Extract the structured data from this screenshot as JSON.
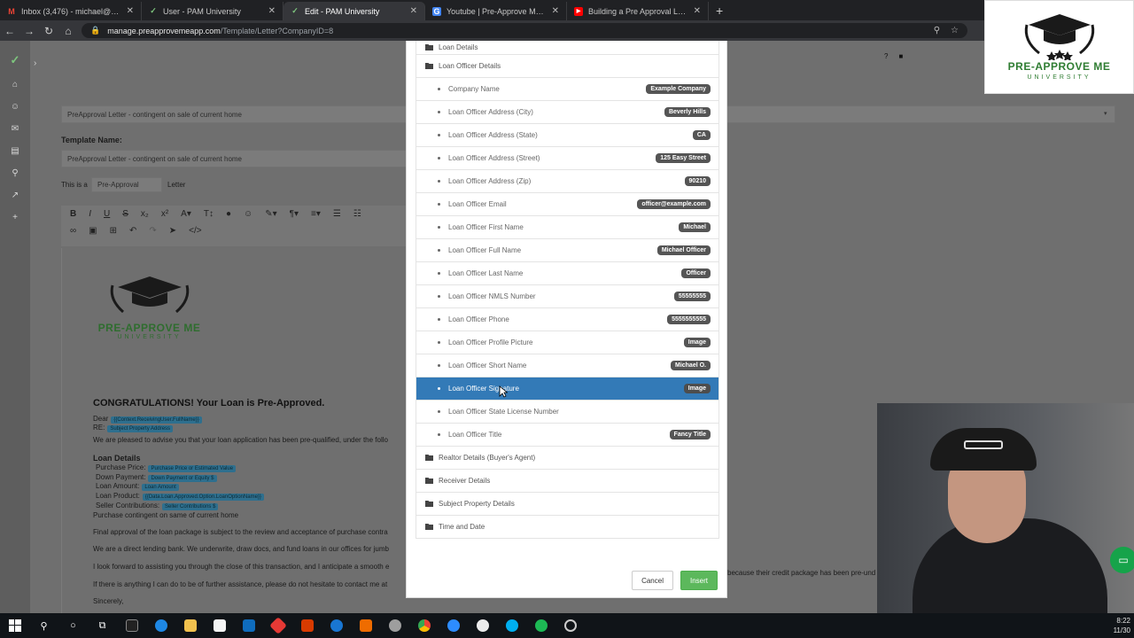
{
  "browser": {
    "tabs": [
      {
        "title": "Inbox (3,476) - michael@preapp...",
        "icon": "gmail-icon",
        "active": false
      },
      {
        "title": "User - PAM University",
        "icon": "pam-icon",
        "active": false
      },
      {
        "title": "Edit - PAM University",
        "icon": "pam-icon",
        "active": true
      },
      {
        "title": "Youtube | Pre-Approve Me (List)",
        "icon": "google-icon",
        "active": false
      },
      {
        "title": "Building a Pre Approval Letter an...",
        "icon": "youtube-icon",
        "active": false
      }
    ],
    "new_tab": "+",
    "address_host": "manage.preapprovemeapp.com",
    "address_path": "/Template/Letter?CompanyID=8"
  },
  "page": {
    "letter_select": "PreApproval Letter - contingent on sale of current home",
    "template_name_label": "Template Name:",
    "template_name_value": "PreApproval Letter - contingent on sale of current home",
    "this_is_a": "This is a",
    "letter_type": "Pre-Approval",
    "letter_word": "Letter",
    "doc": {
      "logo_brand": "PRE-APPROVE ME",
      "logo_sub": "UNIVERSITY",
      "congrats": "CONGRATULATIONS! Your Loan is Pre-Approved.",
      "dear": "Dear",
      "dear_chip": "{{Context.ReceivingUser.FullName}}",
      "re": "RE:",
      "re_chip": "Subject Property Address",
      "para1": "We are pleased to advise you that your loan application has been pre-qualified, under the follo",
      "loan_details": "Loan Details",
      "purchase_price": "Purchase Price:",
      "purchase_price_chip": "Purchase Price or Estimated Value",
      "down_payment": "Down Payment:",
      "down_payment_chip": "Down Payment or Equity $",
      "loan_amount": "Loan Amount:",
      "loan_amount_chip": "Loan Amount",
      "loan_product": "Loan Product:",
      "loan_product_chip": "{{Data.Loan.Approved.Option.LoanOptionName}}",
      "seller_contrib": "Seller Contributions:",
      "seller_contrib_chip": "Seller Contributions $",
      "contingent": "Purchase contingent on same of current home",
      "para2": "Final approval of the loan package is subject to the review and acceptance of purchase contra",
      "para3": "We are a direct lending bank. We underwrite, draw docs, and fund loans in our offices for jumb",
      "para4": "I look forward to assisting you through the close of this transaction, and I anticipate a smooth e",
      "para5": "If there is anything I can do to be of further assistance, please do not hesitate to contact me at",
      "sincerely": "Sincerely,"
    },
    "right_text": "because their credit package has been pre-und"
  },
  "modal": {
    "folders_top": [
      {
        "label": "Loan Details"
      },
      {
        "label": "Loan Officer Details"
      }
    ],
    "items": [
      {
        "name": "Company Name",
        "value": "Example Company"
      },
      {
        "name": "Loan Officer Address (City)",
        "value": "Beverly Hills"
      },
      {
        "name": "Loan Officer Address (State)",
        "value": "CA"
      },
      {
        "name": "Loan Officer Address (Street)",
        "value": "125 Easy Street"
      },
      {
        "name": "Loan Officer Address (Zip)",
        "value": "90210"
      },
      {
        "name": "Loan Officer Email",
        "value": "officer@example.com"
      },
      {
        "name": "Loan Officer First Name",
        "value": "Michael"
      },
      {
        "name": "Loan Officer Full Name",
        "value": "Michael Officer"
      },
      {
        "name": "Loan Officer Last Name",
        "value": "Officer"
      },
      {
        "name": "Loan Officer NMLS Number",
        "value": "55555555"
      },
      {
        "name": "Loan Officer Phone",
        "value": "5555555555"
      },
      {
        "name": "Loan Officer Profile Picture",
        "value": "Image"
      },
      {
        "name": "Loan Officer Short Name",
        "value": "Michael O."
      },
      {
        "name": "Loan Officer Signature",
        "value": "Image",
        "selected": true
      },
      {
        "name": "Loan Officer State License Number",
        "value": ""
      },
      {
        "name": "Loan Officer Title",
        "value": "Fancy Title"
      }
    ],
    "folders_bottom": [
      {
        "label": "Realtor Details (Buyer's Agent)"
      },
      {
        "label": "Receiver Details"
      },
      {
        "label": "Subject Property Details"
      },
      {
        "label": "Time and Date"
      }
    ],
    "cancel_label": "Cancel",
    "insert_label": "Insert"
  },
  "logo_overlay": {
    "brand": "PRE-APPROVE ME",
    "sub": "UNIVERSITY"
  },
  "taskbar": {
    "time": "8:22",
    "date": "11/30"
  },
  "colors": {
    "selected_row": "#337ab7",
    "insert_button": "#5cb85c",
    "brand_green": "#2f7d32",
    "badge": "#555555"
  }
}
